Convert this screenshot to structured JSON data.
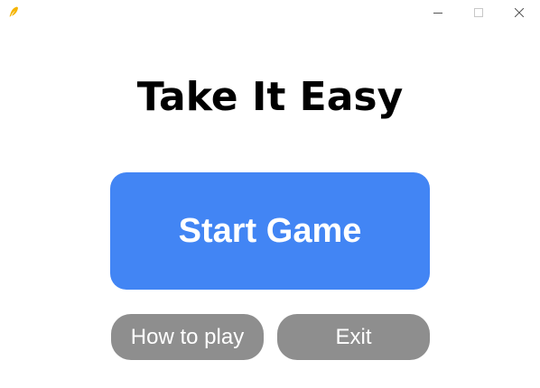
{
  "window": {
    "app_icon": "feather-icon",
    "controls": {
      "minimize_icon": "minimize-icon",
      "maximize_icon": "maximize-icon",
      "close_icon": "close-icon"
    }
  },
  "main": {
    "title": "Take It Easy",
    "start_label": "Start Game",
    "howto_label": "How to play",
    "exit_label": "Exit"
  },
  "colors": {
    "start_button": "#4285f4",
    "secondary_button": "#8e8e8e",
    "text_light": "#ffffff",
    "title_text": "#000000"
  }
}
